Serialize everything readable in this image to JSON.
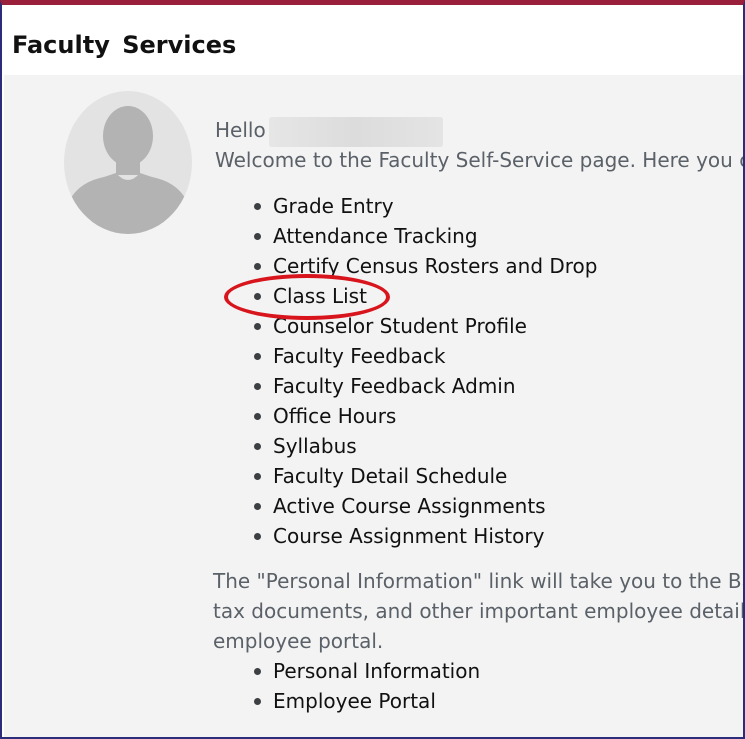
{
  "header": {
    "title": "Faculty  Services"
  },
  "greeting": {
    "hello": "Hello",
    "welcome": "Welcome to the Faculty Self-Service page. Here you car"
  },
  "services": [
    {
      "label": "Grade Entry"
    },
    {
      "label": "Attendance Tracking"
    },
    {
      "label": "Certify Census Rosters and Drop"
    },
    {
      "label": "Class List"
    },
    {
      "label": "Counselor Student Profile"
    },
    {
      "label": "Faculty Feedback"
    },
    {
      "label": "Faculty Feedback Admin"
    },
    {
      "label": "Office Hours"
    },
    {
      "label": "Syllabus"
    },
    {
      "label": "Faculty Detail Schedule"
    },
    {
      "label": "Active Course Assignments"
    },
    {
      "label": "Course Assignment History"
    }
  ],
  "info_paragraph": {
    "line1": "The \"Personal Information\" link will take you to the Bar",
    "line2": "tax documents, and other important employee details",
    "line3": "employee portal."
  },
  "personal_links": [
    {
      "label": "Personal Information"
    },
    {
      "label": "Employee Portal"
    }
  ],
  "annotation": {
    "highlight_color": "#d8141c",
    "highlighted_item": "Class List"
  },
  "colors": {
    "top_border": "#9a1f3a",
    "frame_border": "#2b2d7a",
    "content_bg": "#f3f3f3"
  }
}
